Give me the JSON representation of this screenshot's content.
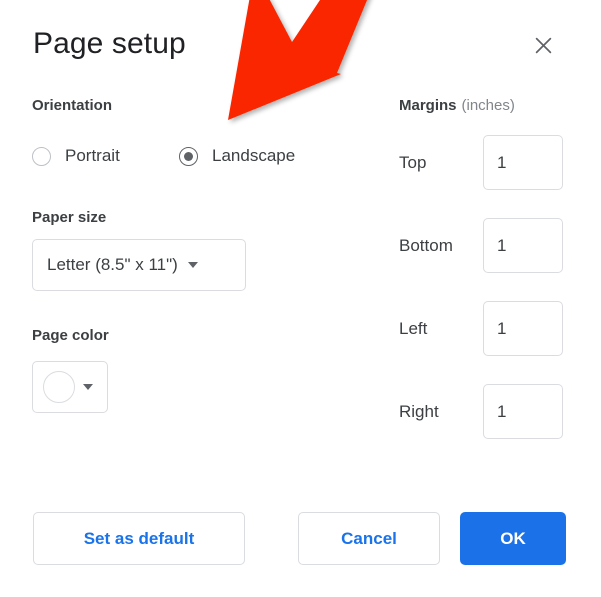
{
  "dialog": {
    "title": "Page setup",
    "close_icon": "close-icon"
  },
  "orientation": {
    "label": "Orientation",
    "options": [
      {
        "label": "Portrait",
        "selected": false
      },
      {
        "label": "Landscape",
        "selected": true
      }
    ]
  },
  "paper_size": {
    "label": "Paper size",
    "value": "Letter (8.5\" x 11\")",
    "caret_icon": "chevron-down-icon"
  },
  "page_color": {
    "label": "Page color",
    "value": "#ffffff",
    "caret_icon": "chevron-down-icon"
  },
  "margins": {
    "title": "Margins",
    "units": "(inches)",
    "fields": [
      {
        "label": "Top",
        "value": "1"
      },
      {
        "label": "Bottom",
        "value": "1"
      },
      {
        "label": "Left",
        "value": "1"
      },
      {
        "label": "Right",
        "value": "1"
      }
    ]
  },
  "footer": {
    "set_default_label": "Set as default",
    "cancel_label": "Cancel",
    "ok_label": "OK"
  },
  "annotation": {
    "arrow_icon": "red-arrow-pointer",
    "arrow_color": "#FA2600",
    "points_at": "Landscape"
  },
  "colors": {
    "accent_blue": "#1a73e8",
    "ok_button_blue": "#1b72e8",
    "text_primary": "#3c4043",
    "text_title": "#202124",
    "text_muted": "#80868b",
    "border": "#dadce0",
    "annotation_red": "#FA2600"
  }
}
